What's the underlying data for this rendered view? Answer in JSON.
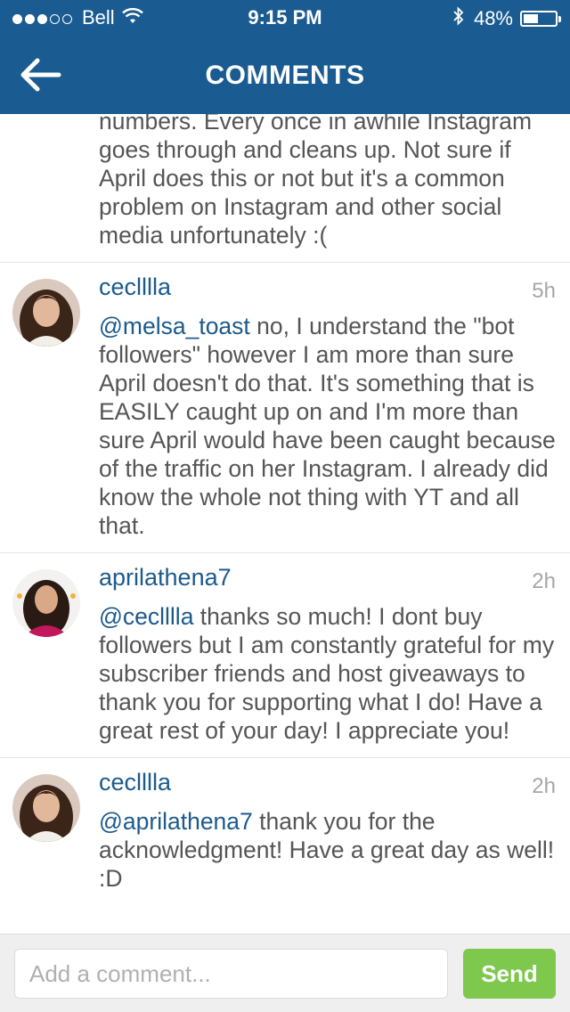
{
  "status_bar": {
    "carrier": "Bell",
    "time": "9:15 PM",
    "battery": "48%",
    "battery_level": 0.48,
    "signal_bars_filled": 3,
    "signal_bars_total": 5
  },
  "header": {
    "title": "COMMENTS",
    "color": "#1a5c91"
  },
  "comments": [
    {
      "continued_text": "numbers. Every once in awhile Instagram goes through and cleans up. Not sure if April does this or not but it's a common problem on Instagram and other social media unfortunately :("
    },
    {
      "username": "ceclllla",
      "time": "5h",
      "mention": "@melsa_toast",
      "text": " no, I understand the \"bot followers\" however I am more than sure April doesn't do that. It's something that is EASILY caught up on and I'm more than sure April would have been caught because of the traffic on her Instagram. I already did know the whole not thing with YT and all that."
    },
    {
      "username": "aprilathena7",
      "time": "2h",
      "mention": "@ceclllla",
      "text": " thanks so much!  I dont buy followers  but I am constantly grateful for my subscriber friends and host giveaways to thank you for supporting what I do!  Have a great rest of your day!  I appreciate you!"
    },
    {
      "username": "ceclllla",
      "time": "2h",
      "mention": "@aprilathena7",
      "text": " thank you for the acknowledgment! Have a great day as well! :D"
    }
  ],
  "composer": {
    "placeholder": "Add a comment...",
    "send_label": "Send",
    "send_color": "#7ec84e"
  }
}
